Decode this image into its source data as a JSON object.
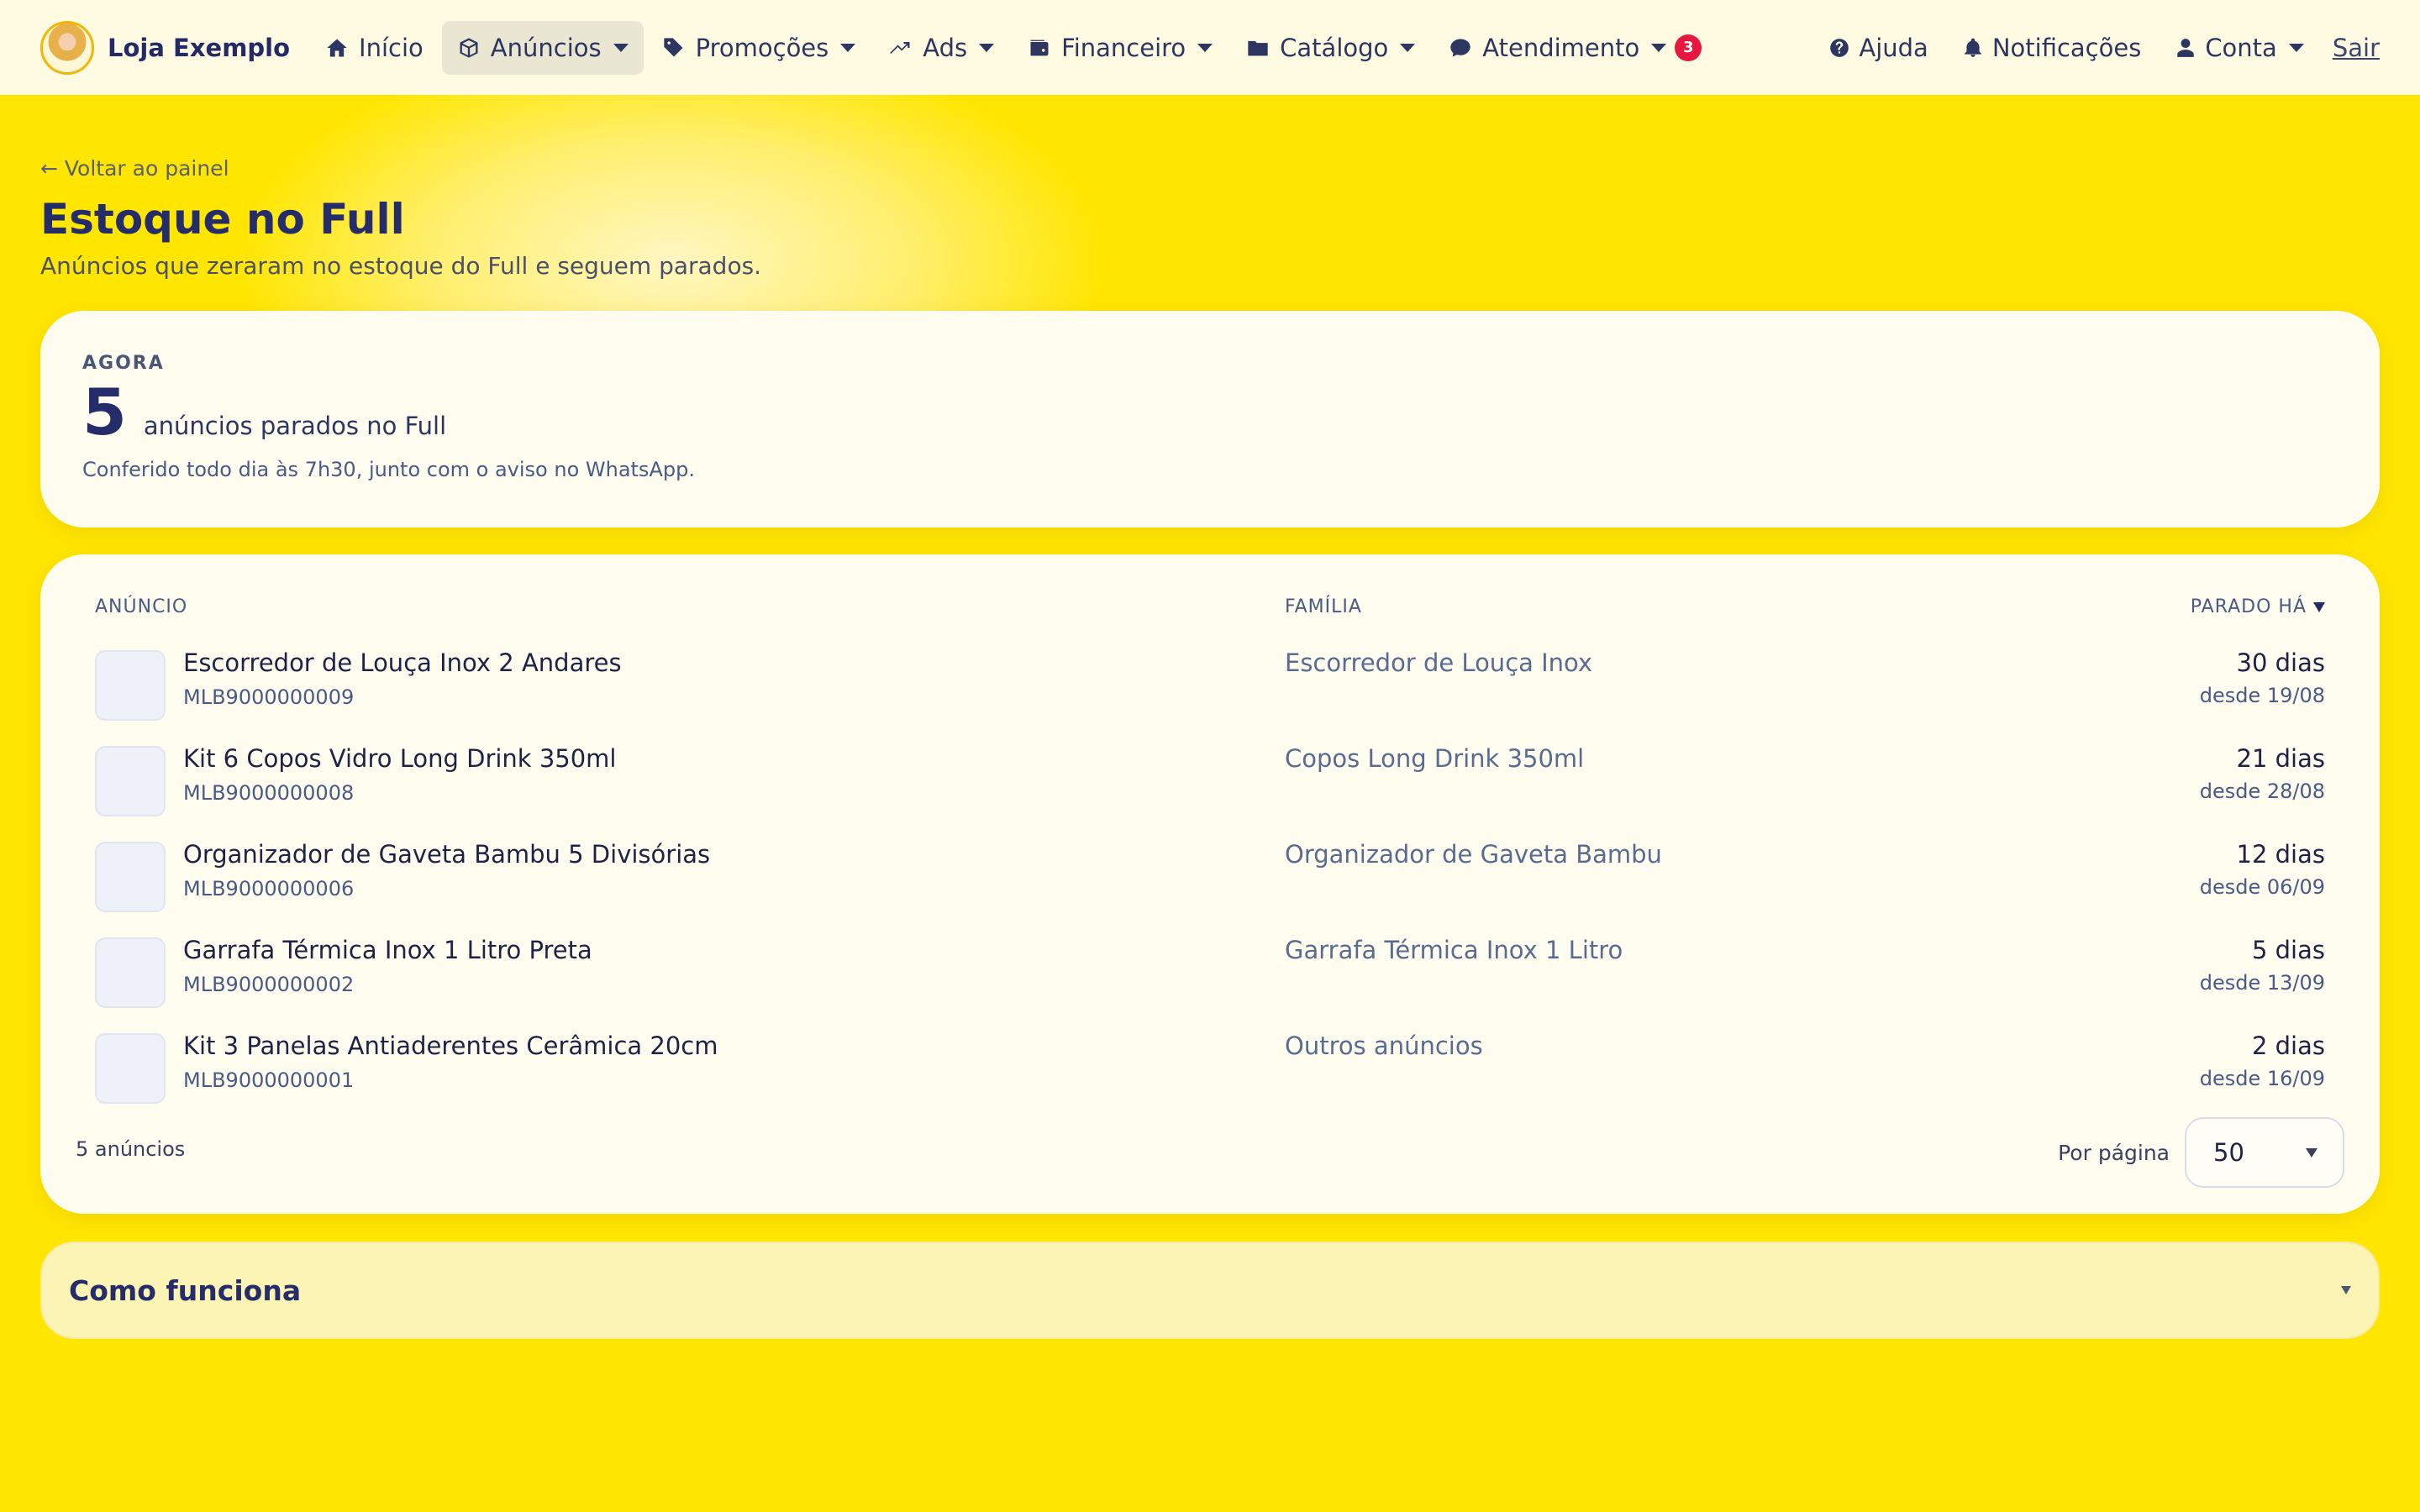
{
  "nav": {
    "brand": "Loja Exemplo",
    "items": [
      {
        "label": "Início",
        "icon": "home-icon"
      },
      {
        "label": "Anúncios",
        "icon": "box-icon"
      },
      {
        "label": "Promoções",
        "icon": "tag-icon"
      },
      {
        "label": "Ads",
        "icon": "trending-up-icon"
      },
      {
        "label": "Financeiro",
        "icon": "wallet-icon"
      },
      {
        "label": "Catálogo",
        "icon": "folder-icon"
      },
      {
        "label": "Atendimento",
        "icon": "chat-icon",
        "badge": "3"
      }
    ],
    "right": {
      "help": "Ajuda",
      "notifications": "Notificações",
      "account": "Conta",
      "logout": "Sair"
    }
  },
  "page": {
    "back": "← Voltar ao painel",
    "title": "Estoque no Full",
    "subtitle": "Anúncios que zeraram no estoque do Full e seguem parados."
  },
  "summary": {
    "kicker": "AGORA",
    "count": "5",
    "count_label": "anúncios parados no Full",
    "note": "Conferido todo dia às 7h30, junto com o aviso no WhatsApp."
  },
  "table": {
    "headers": {
      "anuncio": "ANÚNCIO",
      "familia": "FAMÍLIA",
      "parado": "PARADO HÁ"
    },
    "rows": [
      {
        "name": "Escorredor de Louça Inox 2 Andares",
        "id": "MLB9000000009",
        "family": "Escorredor de Louça Inox",
        "days": "30 dias",
        "since": "desde 19/08"
      },
      {
        "name": "Kit 6 Copos Vidro Long Drink 350ml",
        "id": "MLB9000000008",
        "family": "Copos Long Drink 350ml",
        "days": "21 dias",
        "since": "desde 28/08"
      },
      {
        "name": "Organizador de Gaveta Bambu 5 Divisórias",
        "id": "MLB9000000006",
        "family": "Organizador de Gaveta Bambu",
        "days": "12 dias",
        "since": "desde 06/09"
      },
      {
        "name": "Garrafa Térmica Inox 1 Litro Preta",
        "id": "MLB9000000002",
        "family": "Garrafa Térmica Inox 1 Litro",
        "days": "5 dias",
        "since": "desde 13/09"
      },
      {
        "name": "Kit 3 Panelas Antiaderentes Cerâmica 20cm",
        "id": "MLB9000000001",
        "family": "Outros anúncios",
        "days": "2 dias",
        "since": "desde 16/09"
      }
    ],
    "footer_count": "5 anúncios",
    "per_page_label": "Por página",
    "per_page_value": "50"
  },
  "how": {
    "title": "Como funciona"
  },
  "colors": {
    "background": "#ffe600",
    "navy": "#252c6a",
    "badge": "#e8173f"
  }
}
